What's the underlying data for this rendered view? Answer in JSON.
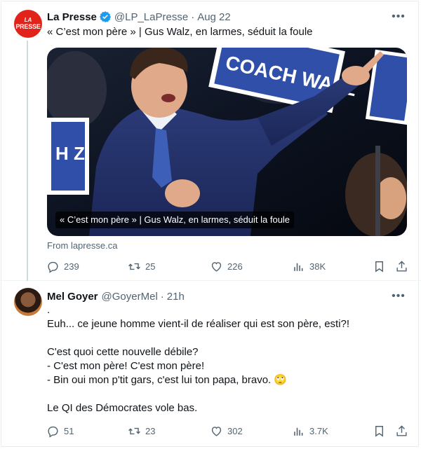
{
  "tweet1": {
    "author_name": "La Presse",
    "logo_text_top": "LA",
    "logo_text_bottom": "PRESSE",
    "handle": "@LP_LaPresse",
    "separator": "·",
    "time": "Aug 22",
    "text": "« C’est mon père » | Gus Walz, en larmes, séduit la foule",
    "card_caption": "« C’est mon père » | Gus Walz, en larmes, séduit la foule",
    "sign_text_left": "H Z",
    "sign_text_right": "COACH WALZ",
    "card_source": "From lapresse.ca",
    "replies": "239",
    "reposts": "25",
    "likes": "226",
    "views": "38K"
  },
  "tweet2": {
    "author_name": "Mel Goyer",
    "handle": "@GoyerMel",
    "separator": "·",
    "time": "21h",
    "text": ".\nEuh... ce jeune homme vient-il de réaliser qui est son père, esti?!\n\nC'est quoi cette nouvelle débile?\n- C'est mon père! C'est mon père!\n- Bin oui mon p'tit gars, c'est lui ton papa, bravo. 🙄\n\nLe QI des Démocrates vole bas.",
    "replies": "51",
    "reposts": "23",
    "likes": "302",
    "views": "3.7K"
  },
  "colors": {
    "brand_red": "#e2231a",
    "verified_blue": "#1d9bf0",
    "secondary_text": "#536471",
    "primary_text": "#0f1419"
  }
}
